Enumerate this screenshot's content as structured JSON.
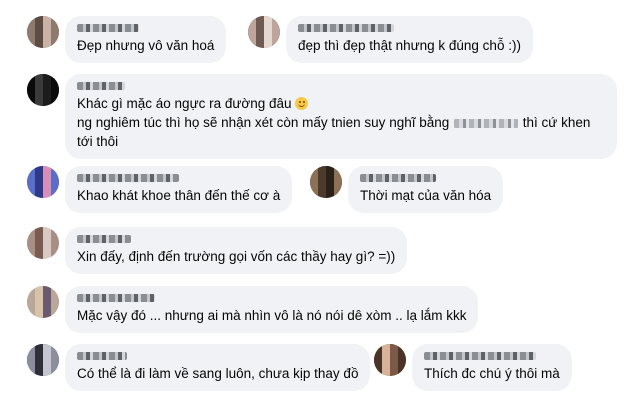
{
  "comments": [
    {
      "id": "c1",
      "text": "Đẹp nhưng vô văn hoá",
      "avatar_colors": [
        "#8f7b6e",
        "#c9b3a6",
        "#5c4c43"
      ]
    },
    {
      "id": "c2",
      "text": "đẹp thì đẹp thật nhưng k đúng chỗ :))",
      "avatar_colors": [
        "#6e5a52",
        "#bda59b",
        "#e5d6cf"
      ]
    },
    {
      "id": "c3",
      "text_line1": "Khác gì mặc áo ngực ra đường đâu",
      "text_line2_before": "ng nghiêm túc thì họ sẽ nhận xét còn mấy tnien suy nghĩ bằng",
      "text_line2_after": "thì cứ khen tới thôi",
      "emoji": "smiling-face-icon",
      "avatar_colors": [
        "#1c1c1c",
        "#3a3a3a",
        "#0a0a0a"
      ]
    },
    {
      "id": "c4",
      "text": "Khao khát khoe thân đến thế cơ à",
      "avatar_colors": [
        "#5a6ec8",
        "#d98fb5",
        "#2d3a8a"
      ]
    },
    {
      "id": "c5",
      "text": "Thời mạt của văn hóa",
      "avatar_colors": [
        "#4a3b2c",
        "#8c7156",
        "#2a2118"
      ]
    },
    {
      "id": "c6",
      "text": "Xin đấy, định đến trường gọi vốn các thầy hay gì? =))",
      "avatar_colors": [
        "#d8c9c3",
        "#7a5b52",
        "#a88f85"
      ]
    },
    {
      "id": "c7",
      "text": "Mặc vậy đó ... nhưng ai mà nhìn vô là nó nói dê xòm .. lạ lắm kkk",
      "avatar_colors": [
        "#b9a89a",
        "#6a5a70",
        "#d6c3a8"
      ]
    },
    {
      "id": "c8",
      "text": "Có thể là đi làm về sang luôn, chưa kịp thay đồ",
      "avatar_colors": [
        "#2f2f3a",
        "#8d8da0",
        "#c5c5d0"
      ]
    },
    {
      "id": "c9",
      "text": "Thích đc chú ý thôi mà",
      "avatar_colors": [
        "#7b5a48",
        "#d8b39a",
        "#4a3327"
      ]
    }
  ],
  "colors": {
    "bubble": "#f0f2f5",
    "text": "#050505"
  }
}
